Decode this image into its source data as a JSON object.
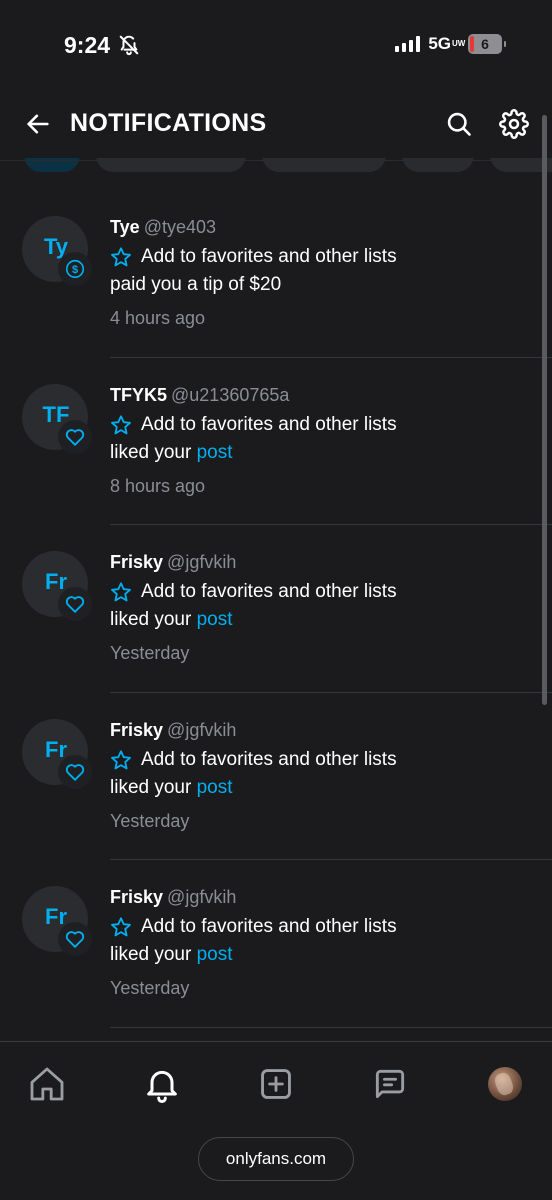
{
  "status_bar": {
    "time": "9:24",
    "network": "5G",
    "network_sup": "UW",
    "battery": "6"
  },
  "header": {
    "title": "NOTIFICATIONS"
  },
  "notifications": [
    {
      "initials": "Ty",
      "name": "Tye",
      "handle": "@tye403",
      "favorite_label": "Add to favorites and other lists",
      "action_text": "paid you a tip of $20",
      "action_link": "",
      "time": "4 hours ago",
      "badge_icon": "dollar-icon"
    },
    {
      "initials": "TF",
      "name": "TFYK5",
      "handle": "@u21360765a",
      "favorite_label": "Add to favorites and other lists",
      "action_text": "liked your ",
      "action_link": "post",
      "time": "8 hours ago",
      "badge_icon": "heart-icon"
    },
    {
      "initials": "Fr",
      "name": "Frisky",
      "handle": "@jgfvkih",
      "favorite_label": "Add to favorites and other lists",
      "action_text": "liked your ",
      "action_link": "post",
      "time": "Yesterday",
      "badge_icon": "heart-icon"
    },
    {
      "initials": "Fr",
      "name": "Frisky",
      "handle": "@jgfvkih",
      "favorite_label": "Add to favorites and other lists",
      "action_text": "liked your ",
      "action_link": "post",
      "time": "Yesterday",
      "badge_icon": "heart-icon"
    },
    {
      "initials": "Fr",
      "name": "Frisky",
      "handle": "@jgfvkih",
      "favorite_label": "Add to favorites and other lists",
      "action_text": "liked your ",
      "action_link": "post",
      "time": "Yesterday",
      "badge_icon": "heart-icon"
    }
  ],
  "bottom_nav": {
    "items": [
      "home-icon",
      "bell-icon",
      "plus-square-icon",
      "chat-icon",
      "profile-avatar"
    ]
  },
  "url_bar": {
    "url": "onlyfans.com"
  },
  "colors": {
    "accent": "#00aff0",
    "background": "#1b1b1d",
    "muted_text": "#8a8d93"
  }
}
